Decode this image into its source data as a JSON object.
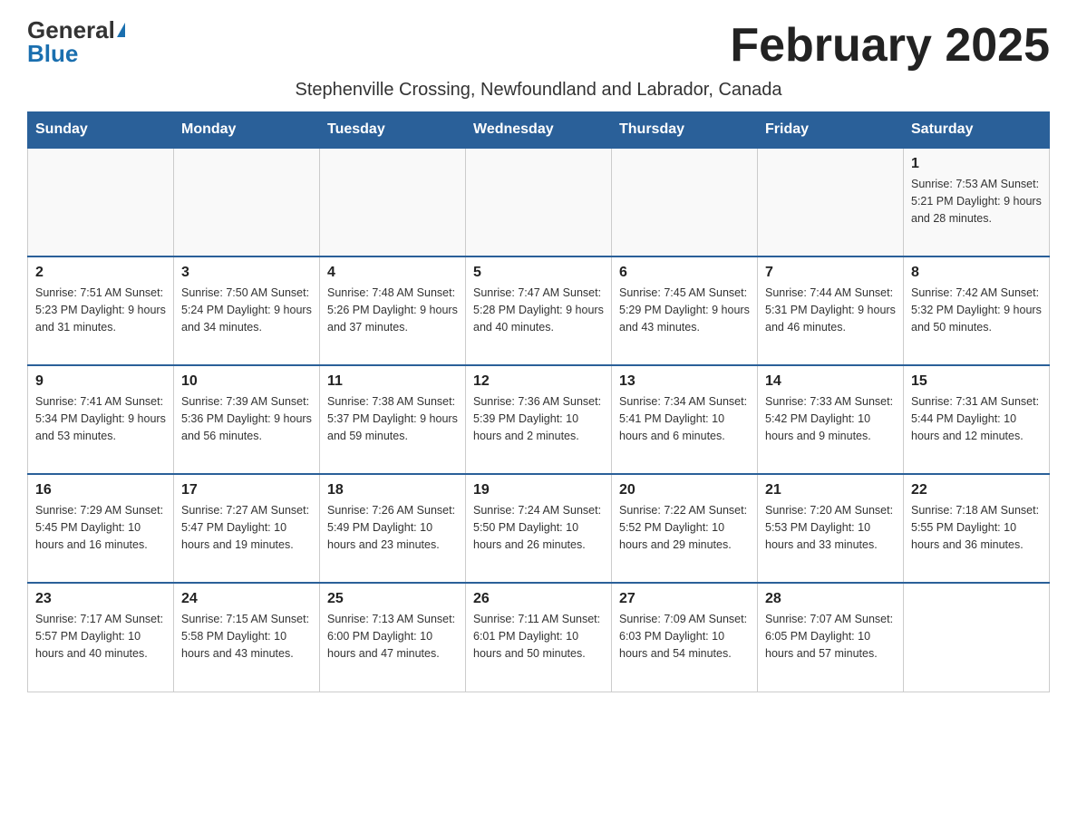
{
  "logo": {
    "general": "General",
    "blue": "Blue"
  },
  "title": "February 2025",
  "subtitle": "Stephenville Crossing, Newfoundland and Labrador, Canada",
  "headers": [
    "Sunday",
    "Monday",
    "Tuesday",
    "Wednesday",
    "Thursday",
    "Friday",
    "Saturday"
  ],
  "weeks": [
    [
      {
        "day": "",
        "info": ""
      },
      {
        "day": "",
        "info": ""
      },
      {
        "day": "",
        "info": ""
      },
      {
        "day": "",
        "info": ""
      },
      {
        "day": "",
        "info": ""
      },
      {
        "day": "",
        "info": ""
      },
      {
        "day": "1",
        "info": "Sunrise: 7:53 AM\nSunset: 5:21 PM\nDaylight: 9 hours and 28 minutes."
      }
    ],
    [
      {
        "day": "2",
        "info": "Sunrise: 7:51 AM\nSunset: 5:23 PM\nDaylight: 9 hours and 31 minutes."
      },
      {
        "day": "3",
        "info": "Sunrise: 7:50 AM\nSunset: 5:24 PM\nDaylight: 9 hours and 34 minutes."
      },
      {
        "day": "4",
        "info": "Sunrise: 7:48 AM\nSunset: 5:26 PM\nDaylight: 9 hours and 37 minutes."
      },
      {
        "day": "5",
        "info": "Sunrise: 7:47 AM\nSunset: 5:28 PM\nDaylight: 9 hours and 40 minutes."
      },
      {
        "day": "6",
        "info": "Sunrise: 7:45 AM\nSunset: 5:29 PM\nDaylight: 9 hours and 43 minutes."
      },
      {
        "day": "7",
        "info": "Sunrise: 7:44 AM\nSunset: 5:31 PM\nDaylight: 9 hours and 46 minutes."
      },
      {
        "day": "8",
        "info": "Sunrise: 7:42 AM\nSunset: 5:32 PM\nDaylight: 9 hours and 50 minutes."
      }
    ],
    [
      {
        "day": "9",
        "info": "Sunrise: 7:41 AM\nSunset: 5:34 PM\nDaylight: 9 hours and 53 minutes."
      },
      {
        "day": "10",
        "info": "Sunrise: 7:39 AM\nSunset: 5:36 PM\nDaylight: 9 hours and 56 minutes."
      },
      {
        "day": "11",
        "info": "Sunrise: 7:38 AM\nSunset: 5:37 PM\nDaylight: 9 hours and 59 minutes."
      },
      {
        "day": "12",
        "info": "Sunrise: 7:36 AM\nSunset: 5:39 PM\nDaylight: 10 hours and 2 minutes."
      },
      {
        "day": "13",
        "info": "Sunrise: 7:34 AM\nSunset: 5:41 PM\nDaylight: 10 hours and 6 minutes."
      },
      {
        "day": "14",
        "info": "Sunrise: 7:33 AM\nSunset: 5:42 PM\nDaylight: 10 hours and 9 minutes."
      },
      {
        "day": "15",
        "info": "Sunrise: 7:31 AM\nSunset: 5:44 PM\nDaylight: 10 hours and 12 minutes."
      }
    ],
    [
      {
        "day": "16",
        "info": "Sunrise: 7:29 AM\nSunset: 5:45 PM\nDaylight: 10 hours and 16 minutes."
      },
      {
        "day": "17",
        "info": "Sunrise: 7:27 AM\nSunset: 5:47 PM\nDaylight: 10 hours and 19 minutes."
      },
      {
        "day": "18",
        "info": "Sunrise: 7:26 AM\nSunset: 5:49 PM\nDaylight: 10 hours and 23 minutes."
      },
      {
        "day": "19",
        "info": "Sunrise: 7:24 AM\nSunset: 5:50 PM\nDaylight: 10 hours and 26 minutes."
      },
      {
        "day": "20",
        "info": "Sunrise: 7:22 AM\nSunset: 5:52 PM\nDaylight: 10 hours and 29 minutes."
      },
      {
        "day": "21",
        "info": "Sunrise: 7:20 AM\nSunset: 5:53 PM\nDaylight: 10 hours and 33 minutes."
      },
      {
        "day": "22",
        "info": "Sunrise: 7:18 AM\nSunset: 5:55 PM\nDaylight: 10 hours and 36 minutes."
      }
    ],
    [
      {
        "day": "23",
        "info": "Sunrise: 7:17 AM\nSunset: 5:57 PM\nDaylight: 10 hours and 40 minutes."
      },
      {
        "day": "24",
        "info": "Sunrise: 7:15 AM\nSunset: 5:58 PM\nDaylight: 10 hours and 43 minutes."
      },
      {
        "day": "25",
        "info": "Sunrise: 7:13 AM\nSunset: 6:00 PM\nDaylight: 10 hours and 47 minutes."
      },
      {
        "day": "26",
        "info": "Sunrise: 7:11 AM\nSunset: 6:01 PM\nDaylight: 10 hours and 50 minutes."
      },
      {
        "day": "27",
        "info": "Sunrise: 7:09 AM\nSunset: 6:03 PM\nDaylight: 10 hours and 54 minutes."
      },
      {
        "day": "28",
        "info": "Sunrise: 7:07 AM\nSunset: 6:05 PM\nDaylight: 10 hours and 57 minutes."
      },
      {
        "day": "",
        "info": ""
      }
    ]
  ]
}
